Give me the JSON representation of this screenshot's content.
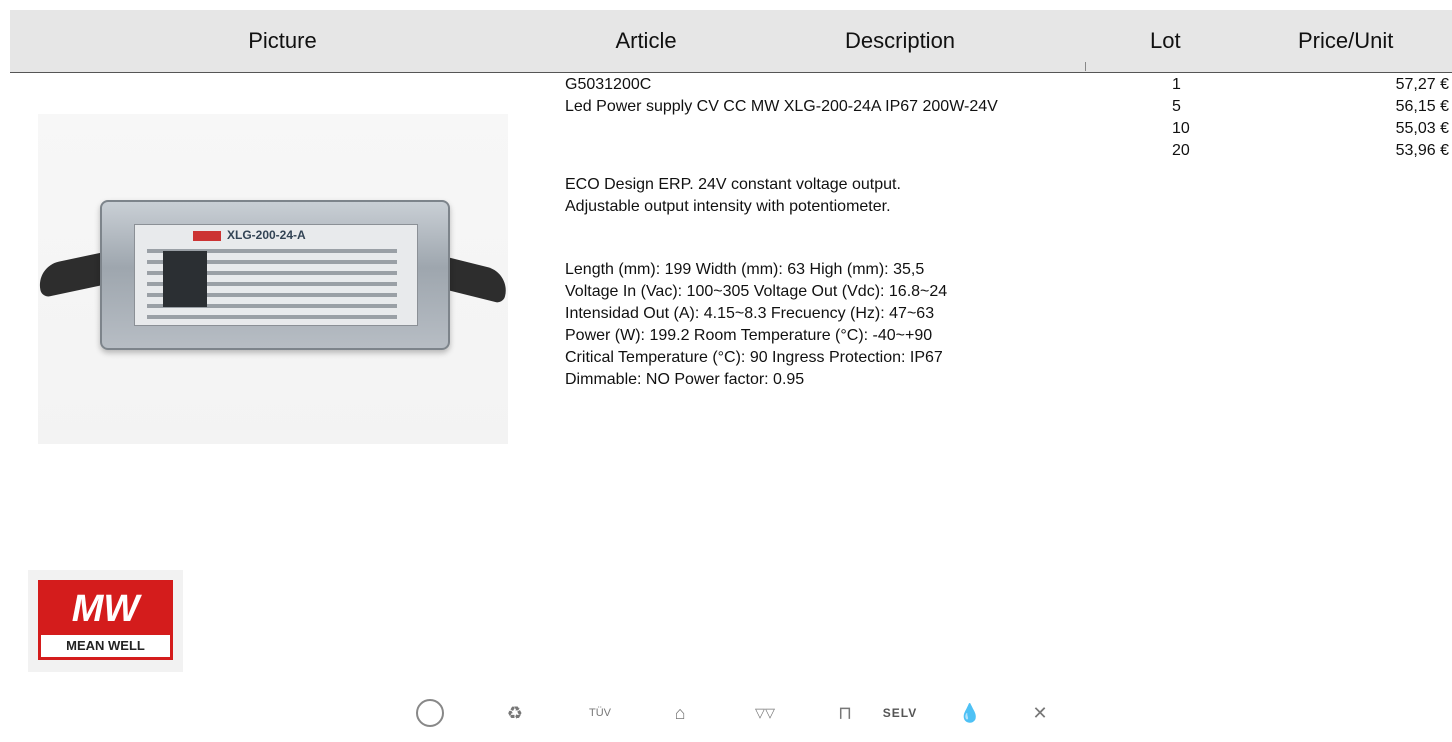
{
  "table": {
    "headers": {
      "picture": "Picture",
      "article": "Article",
      "description": "Description",
      "lot": "Lot",
      "price": "Price/Unit"
    }
  },
  "product": {
    "code": "G5031200C",
    "name": "Led Power supply CV CC MW XLG-200-24A IP67 200W-24V",
    "description": [
      "ECO Design ERP. 24V constant voltage output.",
      "Adjustable output intensity with potentiometer."
    ],
    "specs": [
      "Length (mm): 199 Width (mm): 63 High (mm): 35,5",
      "Voltage In (Vac): 100~305 Voltage Out (Vdc): 16.8~24",
      "Intensidad Out (A): 4.15~8.3 Frecuency (Hz): 47~63",
      "Power (W): 199.2 Room Temperature (°C): -40~+90",
      "Critical Temperature (°C): 90 Ingress Protection: IP67",
      "Dimmable: NO Power factor: 0.95"
    ],
    "image_label": "XLG-200-24-A"
  },
  "pricing": [
    {
      "lot": "1",
      "price": "57,27 €"
    },
    {
      "lot": "5",
      "price": "56,15 €"
    },
    {
      "lot": "10",
      "price": "55,03 €"
    },
    {
      "lot": "20",
      "price": "53,96 €"
    }
  ],
  "brand": {
    "letters": "MW",
    "name": "MEAN WELL",
    "color": "#d41c1c"
  },
  "certification_icons": [
    {
      "name": "class-ii-icon",
      "text": ""
    },
    {
      "name": "weee-bin-icon",
      "text": "♻"
    },
    {
      "name": "tuv-icon",
      "text": "TÜV"
    },
    {
      "name": "ip-rating-icon",
      "text": "⌂"
    },
    {
      "name": "fire-rating-icon",
      "text": "▽▽"
    },
    {
      "name": "sealed-icon",
      "text": "⊓"
    },
    {
      "name": "selv-icon",
      "text": "SELV"
    },
    {
      "name": "water-icon",
      "text": "💧"
    },
    {
      "name": "no-hazard-icon",
      "text": "✕"
    }
  ]
}
